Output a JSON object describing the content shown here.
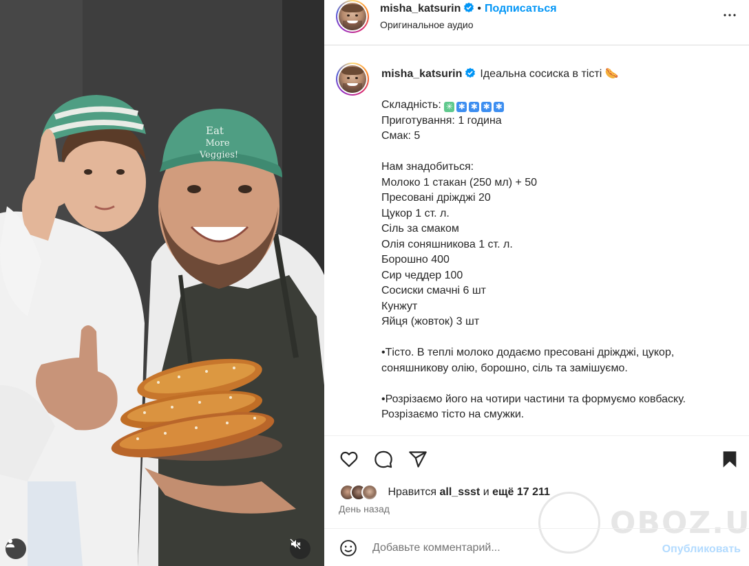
{
  "post": {
    "username": "misha_katsurin",
    "follow_label": "Подписаться",
    "separator": "•",
    "audio_label": "Оригинальное аудио"
  },
  "caption": {
    "username": "misha_katsurin",
    "title": "Ідеальна сосиска в тісті",
    "title_emoji": "🌭",
    "difficulty_label": "Складність:",
    "difficulty_icons": [
      "✳",
      "✱",
      "✱",
      "✱",
      "✱"
    ],
    "lines_top": [
      "Приготування: 1 година",
      "Смак: 5"
    ],
    "ingredients_heading": "Нам знадобиться:",
    "ingredients": [
      "Молоко 1 стакан (250 мл) + 50",
      "Пресовані дріжджі 20",
      "Цукор 1 ст. л.",
      "Сіль за смаком",
      "Олія соняшникова 1 ст. л.",
      "Борошно 400",
      "Сир чеддер 100",
      "Сосиски смачні 6 шт",
      "Кунжут",
      "Яйця (жовток) 3 шт"
    ],
    "step1": "•Тісто. В теплі молоко додаємо пресовані дріжджі, цукор, соняшникову олію, борошно, сіль та замішуємо.",
    "step2": "•Розрізаємо його на чотири частини та формуємо ковбаску. Розрізаємо тісто на смужки."
  },
  "likes": {
    "prefix": "Нравится",
    "user": "all_ssst",
    "joiner": "и",
    "count_text": "ещё 17 211",
    "time": "День назад"
  },
  "comment": {
    "placeholder": "Добавьте комментарий...",
    "publish_label": "Опубликовать"
  },
  "watermark": {
    "text": "OBOZ.UA"
  },
  "colors": {
    "accent": "#0095f6",
    "publish_disabled": "#b3dbff",
    "verified": "#0095f6"
  }
}
